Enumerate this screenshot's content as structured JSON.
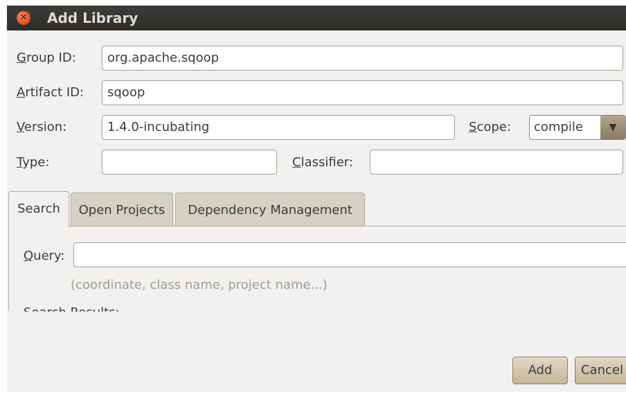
{
  "window": {
    "title": "Add Library",
    "close_icon": "close-icon"
  },
  "form": {
    "group_id": {
      "mnemonic": "G",
      "label_rest": "roup ID:",
      "value": "org.apache.sqoop"
    },
    "artifact_id": {
      "mnemonic": "A",
      "label_rest": "rtifact ID:",
      "value": "sqoop"
    },
    "version": {
      "mnemonic": "V",
      "label_rest": "ersion:",
      "value": "1.4.0-incubating"
    },
    "scope": {
      "mnemonic": "S",
      "label_rest": "cope:",
      "value": "compile",
      "arrow": "▼"
    },
    "type": {
      "mnemonic": "T",
      "label_rest": "ype:",
      "value": ""
    },
    "classifier": {
      "mnemonic": "C",
      "label_rest": "lassifier:",
      "value": ""
    }
  },
  "tabs": [
    {
      "label": "Search",
      "active": true
    },
    {
      "label": "Open Projects",
      "active": false
    },
    {
      "label": "Dependency Management",
      "active": false
    }
  ],
  "search": {
    "query_mnemonic": "Q",
    "query_label_rest": "uery:",
    "query_value": "",
    "hint": "(coordinate, class name, project name...)",
    "results_label": "Search Results:"
  },
  "buttons": {
    "add": "Add",
    "cancel": "Cancel"
  },
  "colors": {
    "titlebar": "#3c3b37",
    "close_button": "#e1542a",
    "button_fill": "#d4c6ae",
    "window_bg": "#f2f1f0"
  }
}
